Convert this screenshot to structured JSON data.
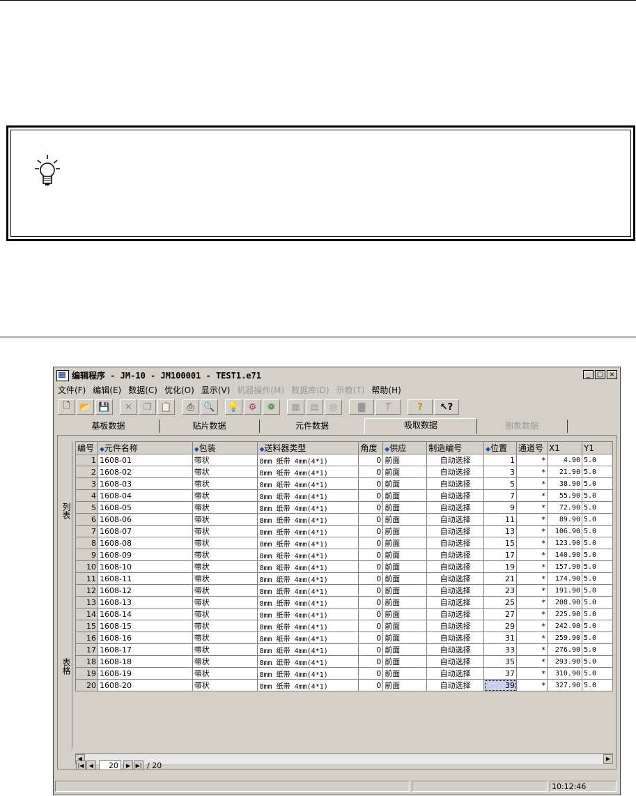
{
  "window": {
    "title": "编辑程序  - JM-10 - JM100001 - TEST1.e71",
    "minimize": "_",
    "maximize": "□",
    "close": "×"
  },
  "menu": [
    {
      "label": "文件(F)",
      "enabled": true
    },
    {
      "label": "编辑(E)",
      "enabled": true
    },
    {
      "label": "数据(C)",
      "enabled": true
    },
    {
      "label": "优化(O)",
      "enabled": true
    },
    {
      "label": "显示(V)",
      "enabled": true
    },
    {
      "label": "机器操作(M)",
      "enabled": false
    },
    {
      "label": "数据库(D)",
      "enabled": false
    },
    {
      "label": "示教(T)",
      "enabled": false
    },
    {
      "label": "帮助(H)",
      "enabled": true
    }
  ],
  "toolbar": [
    "new-icon",
    "open-icon",
    "save-icon",
    "cut-icon",
    "copy-icon",
    "paste-icon",
    "print-icon",
    "find-icon",
    "lightbulb-icon",
    "optimize-icon",
    "color-icon",
    "machine-icon",
    "database-icon",
    "teach-icon",
    "calibrate-icon",
    "text-icon",
    "help-icon",
    "context-help-icon"
  ],
  "tabs": [
    {
      "label": "基板数据",
      "state": "normal"
    },
    {
      "label": "贴片数据",
      "state": "normal"
    },
    {
      "label": "元件数据",
      "state": "normal"
    },
    {
      "label": "吸取数据",
      "state": "active"
    },
    {
      "label": "图象数据",
      "state": "disabled"
    }
  ],
  "side_labels": {
    "list": "列表",
    "table": "表格"
  },
  "columns": [
    "编号",
    "元件名称",
    "包装",
    "送料器类型",
    "角度",
    "供应",
    "制造编号",
    "位置",
    "通道号",
    "X1",
    "Y1"
  ],
  "sortable_columns": [
    1,
    2,
    3,
    5,
    7
  ],
  "rows": [
    {
      "no": "1",
      "name": "1608-01",
      "pkg": "带状",
      "feeder": "8mm 纸带  4mm(4*1)",
      "angle": "0",
      "supply": "前面",
      "mfg": "自动选择",
      "pos": "1",
      "ch": "*",
      "x1": "4.90",
      "y1": "5.0"
    },
    {
      "no": "2",
      "name": "1608-02",
      "pkg": "带状",
      "feeder": "8mm 纸带  4mm(4*1)",
      "angle": "0",
      "supply": "前面",
      "mfg": "自动选择",
      "pos": "3",
      "ch": "*",
      "x1": "21.90",
      "y1": "5.0"
    },
    {
      "no": "3",
      "name": "1608-03",
      "pkg": "带状",
      "feeder": "8mm 纸带  4mm(4*1)",
      "angle": "0",
      "supply": "前面",
      "mfg": "自动选择",
      "pos": "5",
      "ch": "*",
      "x1": "38.90",
      "y1": "5.0"
    },
    {
      "no": "4",
      "name": "1608-04",
      "pkg": "带状",
      "feeder": "8mm 纸带  4mm(4*1)",
      "angle": "0",
      "supply": "前面",
      "mfg": "自动选择",
      "pos": "7",
      "ch": "*",
      "x1": "55.90",
      "y1": "5.0"
    },
    {
      "no": "5",
      "name": "1608-05",
      "pkg": "带状",
      "feeder": "8mm 纸带  4mm(4*1)",
      "angle": "0",
      "supply": "前面",
      "mfg": "自动选择",
      "pos": "9",
      "ch": "*",
      "x1": "72.90",
      "y1": "5.0"
    },
    {
      "no": "6",
      "name": "1608-06",
      "pkg": "带状",
      "feeder": "8mm 纸带  4mm(4*1)",
      "angle": "0",
      "supply": "前面",
      "mfg": "自动选择",
      "pos": "11",
      "ch": "*",
      "x1": "89.90",
      "y1": "5.0"
    },
    {
      "no": "7",
      "name": "1608-07",
      "pkg": "带状",
      "feeder": "8mm 纸带  4mm(4*1)",
      "angle": "0",
      "supply": "前面",
      "mfg": "自动选择",
      "pos": "13",
      "ch": "*",
      "x1": "106.90",
      "y1": "5.0"
    },
    {
      "no": "8",
      "name": "1608-08",
      "pkg": "带状",
      "feeder": "8mm 纸带  4mm(4*1)",
      "angle": "0",
      "supply": "前面",
      "mfg": "自动选择",
      "pos": "15",
      "ch": "*",
      "x1": "123.90",
      "y1": "5.0"
    },
    {
      "no": "9",
      "name": "1608-09",
      "pkg": "带状",
      "feeder": "8mm 纸带  4mm(4*1)",
      "angle": "0",
      "supply": "前面",
      "mfg": "自动选择",
      "pos": "17",
      "ch": "*",
      "x1": "140.90",
      "y1": "5.0"
    },
    {
      "no": "10",
      "name": "1608-10",
      "pkg": "带状",
      "feeder": "8mm 纸带  4mm(4*1)",
      "angle": "0",
      "supply": "前面",
      "mfg": "自动选择",
      "pos": "19",
      "ch": "*",
      "x1": "157.90",
      "y1": "5.0"
    },
    {
      "no": "11",
      "name": "1608-11",
      "pkg": "带状",
      "feeder": "8mm 纸带  4mm(4*1)",
      "angle": "0",
      "supply": "前面",
      "mfg": "自动选择",
      "pos": "21",
      "ch": "*",
      "x1": "174.90",
      "y1": "5.0"
    },
    {
      "no": "12",
      "name": "1608-12",
      "pkg": "带状",
      "feeder": "8mm 纸带  4mm(4*1)",
      "angle": "0",
      "supply": "前面",
      "mfg": "自动选择",
      "pos": "23",
      "ch": "*",
      "x1": "191.90",
      "y1": "5.0"
    },
    {
      "no": "13",
      "name": "1608-13",
      "pkg": "带状",
      "feeder": "8mm 纸带  4mm(4*1)",
      "angle": "0",
      "supply": "前面",
      "mfg": "自动选择",
      "pos": "25",
      "ch": "*",
      "x1": "208.90",
      "y1": "5.0"
    },
    {
      "no": "14",
      "name": "1608-14",
      "pkg": "带状",
      "feeder": "8mm 纸带  4mm(4*1)",
      "angle": "0",
      "supply": "前面",
      "mfg": "自动选择",
      "pos": "27",
      "ch": "*",
      "x1": "225.90",
      "y1": "5.0"
    },
    {
      "no": "15",
      "name": "1608-15",
      "pkg": "带状",
      "feeder": "8mm 纸带  4mm(4*1)",
      "angle": "0",
      "supply": "前面",
      "mfg": "自动选择",
      "pos": "29",
      "ch": "*",
      "x1": "242.90",
      "y1": "5.0"
    },
    {
      "no": "16",
      "name": "1608-16",
      "pkg": "带状",
      "feeder": "8mm 纸带  4mm(4*1)",
      "angle": "0",
      "supply": "前面",
      "mfg": "自动选择",
      "pos": "31",
      "ch": "*",
      "x1": "259.90",
      "y1": "5.0"
    },
    {
      "no": "17",
      "name": "1608-17",
      "pkg": "带状",
      "feeder": "8mm 纸带  4mm(4*1)",
      "angle": "0",
      "supply": "前面",
      "mfg": "自动选择",
      "pos": "33",
      "ch": "*",
      "x1": "276.90",
      "y1": "5.0"
    },
    {
      "no": "18",
      "name": "1608-18",
      "pkg": "带状",
      "feeder": "8mm 纸带  4mm(4*1)",
      "angle": "0",
      "supply": "前面",
      "mfg": "自动选择",
      "pos": "35",
      "ch": "*",
      "x1": "293.90",
      "y1": "5.0"
    },
    {
      "no": "19",
      "name": "1608-19",
      "pkg": "带状",
      "feeder": "8mm 纸带  4mm(4*1)",
      "angle": "0",
      "supply": "前面",
      "mfg": "自动选择",
      "pos": "37",
      "ch": "*",
      "x1": "310.90",
      "y1": "5.0"
    },
    {
      "no": "20",
      "name": "1608-20",
      "pkg": "带状",
      "feeder": "8mm 纸带  4mm(4*1)",
      "angle": "0",
      "supply": "前面",
      "mfg": "自动选择",
      "pos": "39",
      "ch": "*",
      "x1": "327.90",
      "y1": "5.0"
    }
  ],
  "selected_row": 20,
  "navigator": {
    "current": "20",
    "total": "/ 20"
  },
  "status": {
    "time": "10:12:46"
  }
}
